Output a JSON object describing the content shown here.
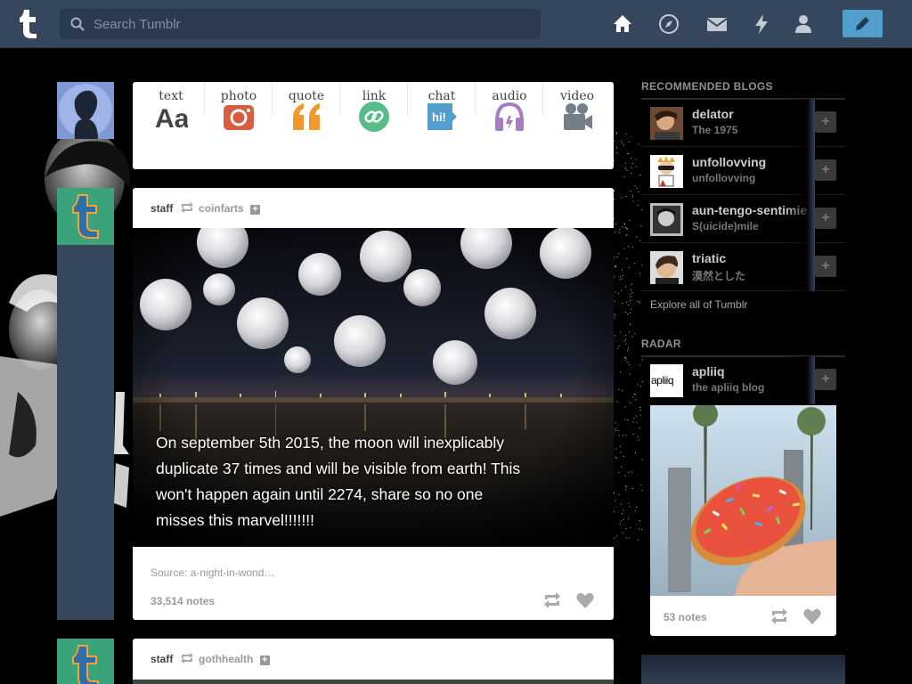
{
  "search": {
    "placeholder": "Search Tumblr"
  },
  "nav": {
    "icons": [
      "home-icon",
      "explore-icon",
      "inbox-icon",
      "activity-icon",
      "account-icon"
    ],
    "compose_icon": "pencil-icon",
    "accent": "#529ecc",
    "bar_color": "#36465d"
  },
  "composer": {
    "types": [
      {
        "label": "text",
        "icon": "text-icon",
        "color": "#444444"
      },
      {
        "label": "photo",
        "icon": "camera-icon",
        "color": "#d95e40"
      },
      {
        "label": "quote",
        "icon": "quote-icon",
        "color": "#f2992e"
      },
      {
        "label": "link",
        "icon": "link-icon",
        "color": "#56bc8a"
      },
      {
        "label": "chat",
        "icon": "chat-icon",
        "color": "#529ecc"
      },
      {
        "label": "audio",
        "icon": "headphones-icon",
        "color": "#a77dc2"
      },
      {
        "label": "video",
        "icon": "video-camera-icon",
        "color": "#748089"
      }
    ]
  },
  "posts": [
    {
      "author": "staff",
      "reblogged_from": "coinfarts",
      "caption": "On september 5th 2015, the moon will inexplicably duplicate 37 times and will be visible from earth! This won't happen again until 2274, share so no one misses this marvel!!!!!!!",
      "source": "Source: a-night-in-wond…",
      "notes": "33,514 notes"
    },
    {
      "author": "staff",
      "reblogged_from": "gothhealth"
    }
  ],
  "sidebar": {
    "recommended_title": "RECOMMENDED BLOGS",
    "recommended": [
      {
        "name": "delator",
        "subtitle": "The 1975"
      },
      {
        "name": "unfollovving",
        "subtitle": "unfollovving"
      },
      {
        "name": "aun-tengo-sentimientos",
        "subtitle": "S(uicide)mile"
      },
      {
        "name": "triatic",
        "subtitle": "漠然とした"
      }
    ],
    "explore_link": "Explore all of Tumblr",
    "radar_title": "RADAR",
    "radar": {
      "name": "apliiq",
      "subtitle": "the apliiq blog",
      "avatar_text": "apliiq",
      "notes": "53 notes"
    },
    "add_label": "+"
  }
}
